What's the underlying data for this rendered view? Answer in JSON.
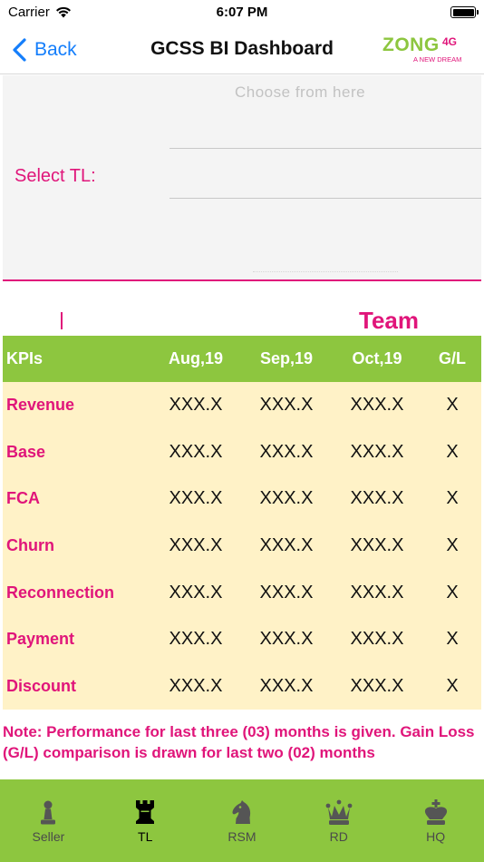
{
  "status_bar": {
    "carrier": "Carrier",
    "time": "6:07 PM"
  },
  "nav": {
    "back_label": "Back",
    "title": "GCSS BI Dashboard"
  },
  "logo": {
    "brand": "ZONG",
    "tag": "4G",
    "tagline": "A NEW DREAM"
  },
  "selector": {
    "label": "Select TL:",
    "placeholder": "Choose from here"
  },
  "section_title": "Team",
  "table": {
    "headers": [
      "KPIs",
      "Aug,19",
      "Sep,19",
      "Oct,19",
      "G/L"
    ],
    "rows": [
      {
        "kpi": "Revenue",
        "aug": "XXX.X",
        "sep": "XXX.X",
        "oct": "XXX.X",
        "gl": "X"
      },
      {
        "kpi": "Base",
        "aug": "XXX.X",
        "sep": "XXX.X",
        "oct": "XXX.X",
        "gl": "X"
      },
      {
        "kpi": "FCA",
        "aug": "XXX.X",
        "sep": "XXX.X",
        "oct": "XXX.X",
        "gl": "X"
      },
      {
        "kpi": "Churn",
        "aug": "XXX.X",
        "sep": "XXX.X",
        "oct": "XXX.X",
        "gl": "X"
      },
      {
        "kpi": "Reconnection",
        "aug": "XXX.X",
        "sep": "XXX.X",
        "oct": "XXX.X",
        "gl": "X"
      },
      {
        "kpi": "Payment",
        "aug": "XXX.X",
        "sep": "XXX.X",
        "oct": "XXX.X",
        "gl": "X"
      },
      {
        "kpi": "Discount",
        "aug": "XXX.X",
        "sep": "XXX.X",
        "oct": "XXX.X",
        "gl": "X"
      }
    ]
  },
  "note": "Note: Performance for last three (03) months is given. Gain Loss (G/L) comparison is drawn for last two (02) months",
  "tabs": [
    {
      "label": "Seller",
      "icon": "chess-pawn-icon",
      "active": false
    },
    {
      "label": "TL",
      "icon": "chess-rook-icon",
      "active": true
    },
    {
      "label": "RSM",
      "icon": "chess-knight-icon",
      "active": false
    },
    {
      "label": "RD",
      "icon": "chess-queen-icon",
      "active": false
    },
    {
      "label": "HQ",
      "icon": "chess-king-icon",
      "active": false
    }
  ],
  "colors": {
    "accent_pink": "#e0157a",
    "brand_green": "#8dc63f",
    "table_row_bg": "#fff2c7",
    "ios_blue": "#147efb"
  }
}
